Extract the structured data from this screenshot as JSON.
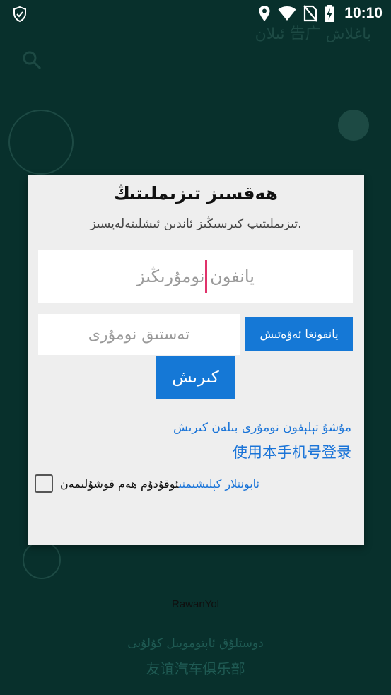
{
  "status_bar": {
    "time": "10:10",
    "icons": [
      "shield-icon",
      "location-icon",
      "wifi-icon",
      "no-sim-icon",
      "battery-charging-icon"
    ]
  },
  "background": {
    "brand": "RawanYol",
    "footer_ug": "دوستلۇق ئاپتوموبىل كۇلۇبى",
    "footer_cn": "友谊汽车俱乐部"
  },
  "dialog": {
    "title": "ھەقسىز تىزىملىتىڭ",
    "subtitle": "تىزىملىتىپ كىرسىڭىز ئاندىن ئىشلىتەلەيسىز.",
    "phone_placeholder": "يانفون نومۇرىڭىز",
    "code_placeholder": "تەستىق نومۇرى",
    "send_code_label": "يانفونغا ئەۋەتىش",
    "login_label": "كىرىش",
    "link_ug": "مۇشۇ تېلېفون نومۇرى بىلەن كىرىش",
    "link_cn": "使用本手机号登录",
    "agree_link": "ئابونتلار كېلىشىمنى",
    "agree_text": "ئوقۇدۇم ھەم قوشۇلىمەن"
  },
  "colors": {
    "accent": "#1578d6",
    "overlay": "#08302c",
    "caret": "#e0336b"
  }
}
